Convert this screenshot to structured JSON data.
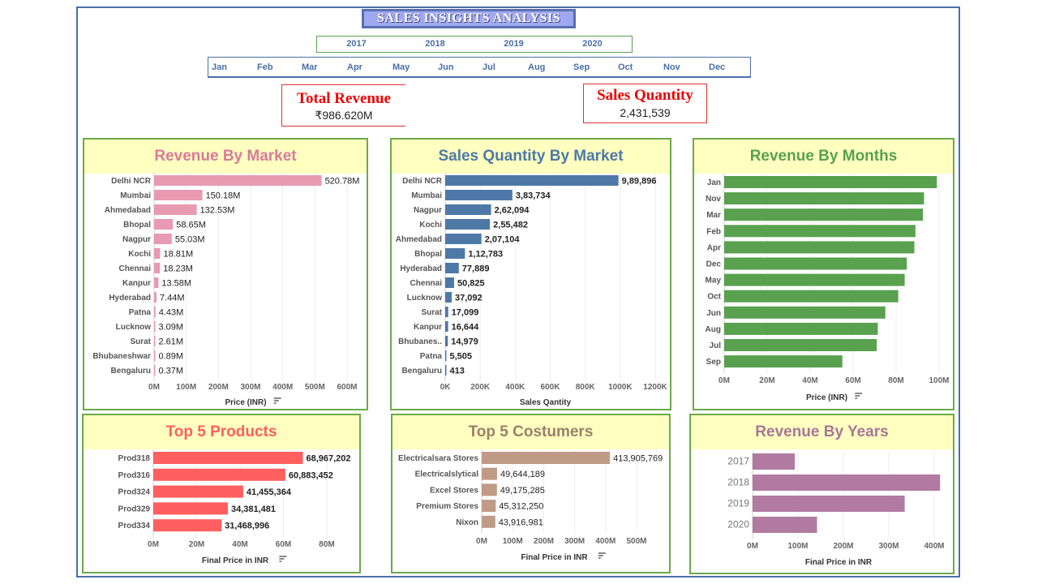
{
  "dashboard": {
    "title": "SALES INSIGHTS ANALYSIS"
  },
  "filters": {
    "years": [
      "2017",
      "2018",
      "2019",
      "2020"
    ],
    "months": [
      "Jan",
      "Feb",
      "Mar",
      "Apr",
      "May",
      "Jun",
      "Jul",
      "Aug",
      "Sep",
      "Oct",
      "Nov",
      "Dec"
    ]
  },
  "kpis": {
    "revenue": {
      "label": "Total Revenue",
      "value": "₹986.620M"
    },
    "quantity": {
      "label": "Sales Quantity",
      "value": "2,431,539"
    }
  },
  "colors": {
    "market_rev": "#e89ab3",
    "market_qty": "#4e79a7",
    "months": "#59a14f",
    "products": "#ff5f5f",
    "customers": "#bf9b86",
    "years": "#b07aa1"
  },
  "chart_data": [
    {
      "id": "revenue_by_market",
      "type": "bar",
      "orientation": "horizontal",
      "title": "Revenue By Market",
      "xlabel": "Price (INR)",
      "categories": [
        "Delhi NCR",
        "Mumbai",
        "Ahmedabad",
        "Bhopal",
        "Nagpur",
        "Kochi",
        "Chennai",
        "Kanpur",
        "Hyderabad",
        "Patna",
        "Lucknow",
        "Surat",
        "Bhubaneshwar",
        "Bengaluru"
      ],
      "values": [
        520.78,
        150.18,
        132.53,
        58.65,
        55.03,
        18.81,
        18.23,
        13.58,
        7.44,
        4.43,
        3.09,
        2.61,
        0.89,
        0.37
      ],
      "value_labels": [
        "520.78M",
        "150.18M",
        "132.53M",
        "58.65M",
        "55.03M",
        "18.81M",
        "18.23M",
        "13.58M",
        "7.44M",
        "4.43M",
        "3.09M",
        "2.61M",
        "0.89M",
        "0.37M"
      ],
      "ticks": [
        "0M",
        "100M",
        "200M",
        "300M",
        "400M",
        "500M",
        "600M"
      ],
      "tick_values": [
        0,
        100,
        200,
        300,
        400,
        500,
        600
      ],
      "xlim": [
        0,
        600
      ]
    },
    {
      "id": "sales_qty_by_market",
      "type": "bar",
      "orientation": "horizontal",
      "title": "Sales Quantity By Market",
      "xlabel": "Sales Qantity",
      "categories": [
        "Delhi NCR",
        "Mumbai",
        "Nagpur",
        "Kochi",
        "Ahmedabad",
        "Bhopal",
        "Hyderabad",
        "Chennai",
        "Lucknow",
        "Surat",
        "Kanpur",
        "Bhubanes..",
        "Patna",
        "Bengaluru"
      ],
      "values": [
        989896,
        383734,
        262094,
        255482,
        207104,
        112783,
        77889,
        50825,
        37092,
        17099,
        16644,
        14979,
        5505,
        413
      ],
      "value_labels": [
        "9,89,896",
        "3,83,734",
        "2,62,094",
        "2,55,482",
        "2,07,104",
        "1,12,783",
        "77,889",
        "50,825",
        "37,092",
        "17,099",
        "16,644",
        "14,979",
        "5,505",
        "413"
      ],
      "ticks": [
        "0K",
        "200K",
        "400K",
        "600K",
        "800K",
        "1000K",
        "1200K"
      ],
      "tick_values": [
        0,
        200000,
        400000,
        600000,
        800000,
        1000000,
        1200000
      ],
      "xlim": [
        0,
        1200000
      ]
    },
    {
      "id": "revenue_by_months",
      "type": "bar",
      "orientation": "horizontal",
      "title": "Revenue By Months",
      "xlabel": "Price (INR)",
      "categories": [
        "Jan",
        "Nov",
        "Mar",
        "Feb",
        "Apr",
        "Dec",
        "May",
        "Oct",
        "Jun",
        "Aug",
        "Jul",
        "Sep"
      ],
      "values": [
        99,
        93,
        92.5,
        89,
        88.5,
        85,
        84,
        81,
        75,
        71.5,
        71,
        55
      ],
      "ticks": [
        "0M",
        "20M",
        "40M",
        "60M",
        "80M",
        "100M"
      ],
      "tick_values": [
        0,
        20,
        40,
        60,
        80,
        100
      ],
      "xlim": [
        0,
        100
      ]
    },
    {
      "id": "top5_products",
      "type": "bar",
      "orientation": "horizontal",
      "title": "Top 5 Products",
      "xlabel": "Final Price in INR",
      "categories": [
        "Prod318",
        "Prod316",
        "Prod324",
        "Prod329",
        "Prod334"
      ],
      "values": [
        68967202,
        60883452,
        41455364,
        34381481,
        31468996
      ],
      "value_labels": [
        "68,967,202",
        "60,883,452",
        "41,455,364",
        "34,381,481",
        "31,468,996"
      ],
      "ticks": [
        "0M",
        "20M",
        "40M",
        "60M",
        "80M"
      ],
      "tick_values": [
        0,
        20000000,
        40000000,
        60000000,
        80000000
      ],
      "xlim": [
        0,
        80000000
      ]
    },
    {
      "id": "top5_customers",
      "type": "bar",
      "orientation": "horizontal",
      "title": "Top 5 Costumers",
      "xlabel": "Final Price in INR",
      "categories": [
        "Electricalsara Stores",
        "Electricalslytical",
        "Excel Stores",
        "Premium Stores",
        "Nixon"
      ],
      "values": [
        413905769,
        49644189,
        49175285,
        45312250,
        43916981
      ],
      "value_labels": [
        "413,905,769",
        "49,644,189",
        "49,175,285",
        "45,312,250",
        "43,916,981"
      ],
      "ticks": [
        "0M",
        "100M",
        "200M",
        "300M",
        "400M",
        "500M"
      ],
      "tick_values": [
        0,
        100000000,
        200000000,
        300000000,
        400000000,
        500000000
      ],
      "xlim": [
        0,
        500000000
      ]
    },
    {
      "id": "revenue_by_years",
      "type": "bar",
      "orientation": "horizontal",
      "title": "Revenue By Years",
      "xlabel": "Final Price in INR",
      "categories": [
        "2017",
        "2018",
        "2019",
        "2020"
      ],
      "values": [
        93,
        413,
        335,
        142
      ],
      "ticks": [
        "0M",
        "100M",
        "200M",
        "300M",
        "400M"
      ],
      "tick_values": [
        0,
        100,
        200,
        300,
        400
      ],
      "xlim": [
        0,
        400
      ]
    }
  ]
}
